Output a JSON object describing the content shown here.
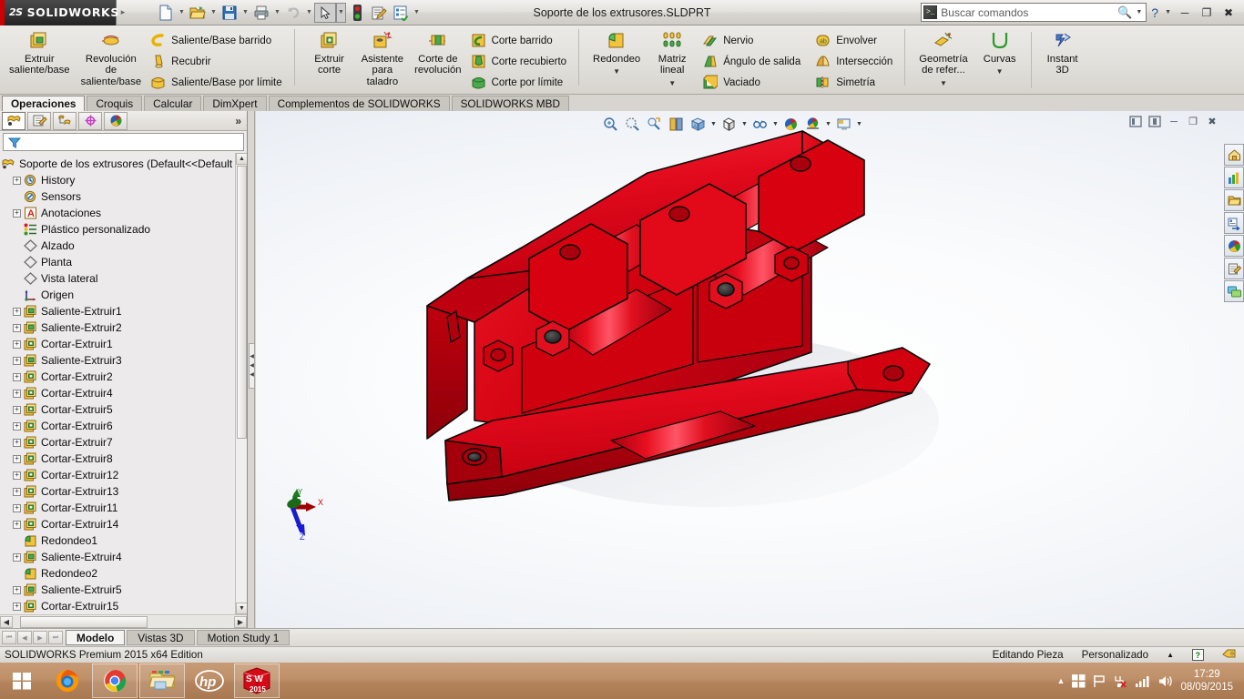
{
  "titlebar": {
    "logo_ds": "2S",
    "logo_text": "SOLIDWORKS",
    "document_title": "Soporte de los extrusores.SLDPRT",
    "search_placeholder": "Buscar comandos",
    "quick_access": [
      {
        "name": "new-document",
        "label": "Nuevo"
      },
      {
        "name": "open-document",
        "label": "Abrir"
      },
      {
        "name": "save-document",
        "label": "Guardar"
      },
      {
        "name": "print-document",
        "label": "Imprimir"
      },
      {
        "name": "undo",
        "label": "Deshacer"
      },
      {
        "name": "select",
        "label": "Seleccionar"
      },
      {
        "name": "rebuild",
        "label": "Reconstruir"
      },
      {
        "name": "file-properties",
        "label": "Propiedades"
      },
      {
        "name": "options",
        "label": "Opciones"
      }
    ],
    "window_buttons": [
      "minimize",
      "restore",
      "close"
    ]
  },
  "ribbon": {
    "groups": [
      {
        "name": "features-boss",
        "big": [
          {
            "label": "Extruir\nsaliente/base",
            "icon": "extrude-boss-icon"
          },
          {
            "label": "Revolución\nde\nsaliente/base",
            "icon": "revolve-boss-icon"
          }
        ],
        "small": [
          {
            "label": "Saliente/Base barrido",
            "icon": "swept-boss-icon"
          },
          {
            "label": "Recubrir",
            "icon": "loft-icon"
          },
          {
            "label": "Saliente/Base por límite",
            "icon": "boundary-boss-icon"
          }
        ]
      },
      {
        "name": "features-cut",
        "big": [
          {
            "label": "Extruir\ncorte",
            "icon": "extrude-cut-icon"
          },
          {
            "label": "Asistente\npara\ntaladro",
            "icon": "hole-wizard-icon"
          },
          {
            "label": "Corte de\nrevolución",
            "icon": "revolve-cut-icon"
          }
        ],
        "small": [
          {
            "label": "Corte barrido",
            "icon": "swept-cut-icon"
          },
          {
            "label": "Corte recubierto",
            "icon": "lofted-cut-icon"
          },
          {
            "label": "Corte por límite",
            "icon": "boundary-cut-icon"
          }
        ]
      },
      {
        "name": "features-modify",
        "big": [
          {
            "label": "Redondeo",
            "icon": "fillet-icon"
          },
          {
            "label": "Matriz\nlineal",
            "icon": "linear-pattern-icon"
          }
        ],
        "small": [
          {
            "label": "Nervio",
            "icon": "rib-icon"
          },
          {
            "label": "Ángulo de salida",
            "icon": "draft-icon"
          },
          {
            "label": "Vaciado",
            "icon": "shell-icon"
          }
        ]
      },
      {
        "name": "features-combine",
        "small": [
          {
            "label": "Envolver",
            "icon": "wrap-icon"
          },
          {
            "label": "Intersección",
            "icon": "intersect-icon"
          },
          {
            "label": "Simetría",
            "icon": "mirror-icon"
          }
        ]
      },
      {
        "name": "features-reference",
        "big": [
          {
            "label": "Geometría\nde refer...",
            "icon": "reference-geometry-icon"
          },
          {
            "label": "Curvas",
            "icon": "curves-icon"
          },
          {
            "label": "Instant\n3D",
            "icon": "instant3d-icon"
          }
        ]
      }
    ],
    "tabs": [
      {
        "label": "Operaciones",
        "active": true
      },
      {
        "label": "Croquis",
        "active": false
      },
      {
        "label": "Calcular",
        "active": false
      },
      {
        "label": "DimXpert",
        "active": false
      },
      {
        "label": "Complementos de SOLIDWORKS",
        "active": false
      },
      {
        "label": "SOLIDWORKS MBD",
        "active": false
      }
    ]
  },
  "feature_manager": {
    "tabs": [
      {
        "name": "feature-manager-tab",
        "selected": true
      },
      {
        "name": "property-manager-tab",
        "selected": false
      },
      {
        "name": "configuration-manager-tab",
        "selected": false
      },
      {
        "name": "dimxpert-manager-tab",
        "selected": false
      },
      {
        "name": "display-manager-tab",
        "selected": false
      }
    ],
    "more_label": "»",
    "filter_placeholder": "",
    "root": "Soporte de los extrusores  (Default<<Default",
    "tree": [
      {
        "label": "History",
        "icon": "history-icon",
        "expandable": true,
        "indent": 1
      },
      {
        "label": "Sensors",
        "icon": "sensors-icon",
        "expandable": false,
        "indent": 1
      },
      {
        "label": "Anotaciones",
        "icon": "annotations-icon",
        "expandable": true,
        "indent": 1
      },
      {
        "label": "Plástico personalizado",
        "icon": "material-icon",
        "expandable": false,
        "indent": 1
      },
      {
        "label": "Alzado",
        "icon": "plane-icon",
        "expandable": false,
        "indent": 1
      },
      {
        "label": "Planta",
        "icon": "plane-icon",
        "expandable": false,
        "indent": 1
      },
      {
        "label": "Vista lateral",
        "icon": "plane-icon",
        "expandable": false,
        "indent": 1
      },
      {
        "label": "Origen",
        "icon": "origin-icon",
        "expandable": false,
        "indent": 1
      },
      {
        "label": "Saliente-Extruir1",
        "icon": "boss-extrude-icon",
        "expandable": true,
        "indent": 1
      },
      {
        "label": "Saliente-Extruir2",
        "icon": "boss-extrude-icon",
        "expandable": true,
        "indent": 1
      },
      {
        "label": "Cortar-Extruir1",
        "icon": "cut-extrude-icon",
        "expandable": true,
        "indent": 1
      },
      {
        "label": "Saliente-Extruir3",
        "icon": "boss-extrude-icon",
        "expandable": true,
        "indent": 1
      },
      {
        "label": "Cortar-Extruir2",
        "icon": "cut-extrude-icon",
        "expandable": true,
        "indent": 1
      },
      {
        "label": "Cortar-Extruir4",
        "icon": "cut-extrude-icon",
        "expandable": true,
        "indent": 1
      },
      {
        "label": "Cortar-Extruir5",
        "icon": "cut-extrude-icon",
        "expandable": true,
        "indent": 1
      },
      {
        "label": "Cortar-Extruir6",
        "icon": "cut-extrude-icon",
        "expandable": true,
        "indent": 1
      },
      {
        "label": "Cortar-Extruir7",
        "icon": "cut-extrude-icon",
        "expandable": true,
        "indent": 1
      },
      {
        "label": "Cortar-Extruir8",
        "icon": "cut-extrude-icon",
        "expandable": true,
        "indent": 1
      },
      {
        "label": "Cortar-Extruir12",
        "icon": "cut-extrude-icon",
        "expandable": true,
        "indent": 1
      },
      {
        "label": "Cortar-Extruir13",
        "icon": "cut-extrude-icon",
        "expandable": true,
        "indent": 1
      },
      {
        "label": "Cortar-Extruir11",
        "icon": "cut-extrude-icon",
        "expandable": true,
        "indent": 1
      },
      {
        "label": "Cortar-Extruir14",
        "icon": "cut-extrude-icon",
        "expandable": true,
        "indent": 1
      },
      {
        "label": "Redondeo1",
        "icon": "fillet-feature-icon",
        "expandable": false,
        "indent": 1
      },
      {
        "label": "Saliente-Extruir4",
        "icon": "boss-extrude-icon",
        "expandable": true,
        "indent": 1
      },
      {
        "label": "Redondeo2",
        "icon": "fillet-feature-icon",
        "expandable": false,
        "indent": 1
      },
      {
        "label": "Saliente-Extruir5",
        "icon": "boss-extrude-icon",
        "expandable": true,
        "indent": 1
      },
      {
        "label": "Cortar-Extruir15",
        "icon": "cut-extrude-icon",
        "expandable": true,
        "indent": 1
      }
    ]
  },
  "graphics": {
    "heads_up_toolbar": [
      {
        "name": "zoom-to-fit-icon"
      },
      {
        "name": "zoom-to-area-icon"
      },
      {
        "name": "previous-view-icon"
      },
      {
        "name": "section-view-icon"
      },
      {
        "name": "view-orientation-icon"
      },
      {
        "name": "display-style-icon"
      },
      {
        "name": "hide-show-items-icon"
      },
      {
        "name": "edit-appearance-icon"
      },
      {
        "name": "apply-scene-icon"
      },
      {
        "name": "view-settings-icon"
      }
    ],
    "document_window_buttons": [
      "restore-down",
      "maximize",
      "minimize",
      "restore",
      "close"
    ],
    "triad_axes": [
      {
        "label": "X",
        "color": "#c00000"
      },
      {
        "label": "Y",
        "color": "#008000"
      },
      {
        "label": "Z",
        "color": "#0000cc"
      }
    ],
    "model": {
      "name": "Soporte de los extrusores",
      "body_color": "#e00018",
      "edge_color": "#000000"
    },
    "task_pane": [
      {
        "name": "sw-resources-tab"
      },
      {
        "name": "design-library-tab"
      },
      {
        "name": "file-explorer-tab"
      },
      {
        "name": "view-palette-tab"
      },
      {
        "name": "appearances-scenes-tab"
      },
      {
        "name": "custom-properties-tab"
      },
      {
        "name": "solidworks-forum-tab"
      }
    ]
  },
  "bottom_tabs": [
    {
      "label": "Modelo",
      "active": true
    },
    {
      "label": "Vistas 3D",
      "active": false
    },
    {
      "label": "Motion Study 1",
      "active": false
    }
  ],
  "statusbar": {
    "edition": "SOLIDWORKS Premium 2015 x64 Edition",
    "mode": "Editando Pieza",
    "units": "Personalizado"
  },
  "taskbar": {
    "items": [
      {
        "name": "start-button",
        "label": "Inicio"
      },
      {
        "name": "firefox-taskbar-icon",
        "label": "Mozilla Firefox"
      },
      {
        "name": "chrome-taskbar-icon",
        "label": "Google Chrome"
      },
      {
        "name": "file-explorer-taskbar-icon",
        "label": "Explorador de archivos"
      },
      {
        "name": "hp-taskbar-icon",
        "label": "HP"
      },
      {
        "name": "solidworks-taskbar-icon",
        "label": "SOLIDWORKS 2015"
      }
    ],
    "sw_icon_text": "S W",
    "sw_icon_year": "2015",
    "tray": [
      {
        "name": "show-hidden-icons"
      },
      {
        "name": "windows-icon"
      },
      {
        "name": "action-center-flag-icon"
      },
      {
        "name": "network-error-icon"
      },
      {
        "name": "signal-icon"
      },
      {
        "name": "volume-icon"
      }
    ],
    "time": "17:29",
    "date": "08/09/2015"
  }
}
